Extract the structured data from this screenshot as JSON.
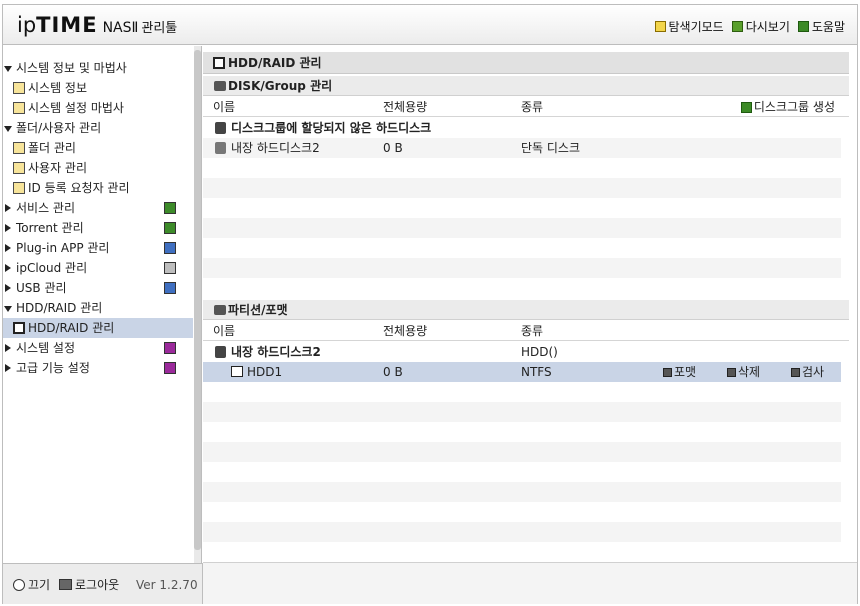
{
  "header": {
    "logo_ip": "ip",
    "logo_time": "TIME",
    "logo_nas": "NASⅡ",
    "logo_tool": "관리툴",
    "links": [
      {
        "label": "탐색기모드",
        "icon": "folder-icon"
      },
      {
        "label": "다시보기",
        "icon": "refresh-icon"
      },
      {
        "label": "도움말",
        "icon": "help-icon"
      }
    ]
  },
  "sidebar": {
    "system_info_group": "시스템 정보 및 마법사",
    "system_info": "시스템 정보",
    "setup_wizard": "시스템 설정 마법사",
    "folder_user_group": "폴더/사용자 관리",
    "folder_mgmt": "폴더 관리",
    "user_mgmt": "사용자 관리",
    "id_request": "ID 등록 요청자 관리",
    "service_mgmt": "서비스 관리",
    "torrent_mgmt": "Torrent 관리",
    "plugin_mgmt": "Plug-in APP 관리",
    "ipcloud_mgmt": "ipCloud 관리",
    "usb_mgmt": "USB 관리",
    "hdd_group": "HDD/RAID 관리",
    "hdd_item": "HDD/RAID 관리",
    "system_settings": "시스템 설정",
    "advanced_settings": "고급 기능 설정"
  },
  "footer": {
    "power": "끄기",
    "logout": "로그아웃",
    "version": "Ver 1.2.70"
  },
  "main": {
    "title": "HDD/RAID 관리",
    "disk_section": {
      "title": "DISK/Group 관리",
      "col_name": "이름",
      "col_capacity": "전체용량",
      "col_type": "종류",
      "create_group": "디스크그룹 생성",
      "unassigned_label": "디스크그룹에 할당되지 않은 하드디스크",
      "disk_name": "내장 하드디스크2",
      "disk_capacity": "0 B",
      "disk_type": "단독 디스크"
    },
    "partition_section": {
      "title": "파티션/포맷",
      "col_name": "이름",
      "col_capacity": "전체용량",
      "col_type": "종류",
      "disk_name": "내장 하드디스크2",
      "disk_type": "HDD()",
      "partition_name": "HDD1",
      "partition_capacity": "0 B",
      "partition_type": "NTFS",
      "format": "포맷",
      "delete": "삭제",
      "check": "검사"
    }
  }
}
